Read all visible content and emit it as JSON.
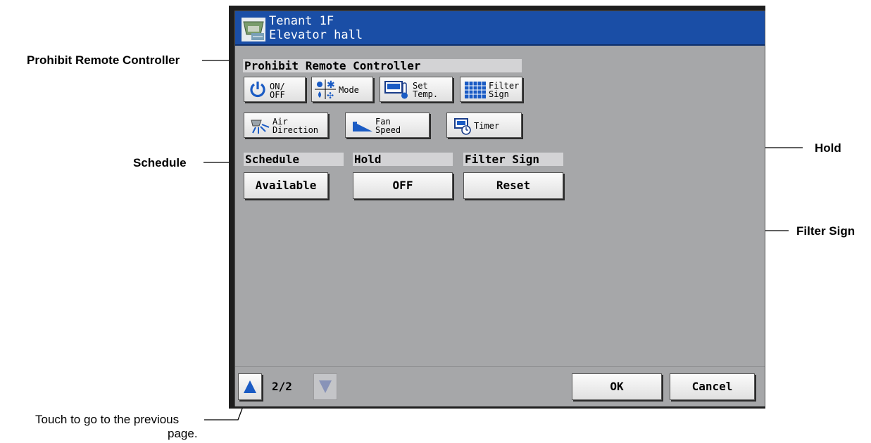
{
  "annotations": {
    "prohibit": "Prohibit Remote Controller",
    "schedule": "Schedule",
    "hold": "Hold",
    "filter_sign": "Filter Sign",
    "touch_prev_line1": "Touch to go to the previous",
    "touch_prev_line2": "page."
  },
  "title": {
    "line1": "Tenant 1F",
    "line2": "Elevator hall"
  },
  "prohibit": {
    "header": "Prohibit Remote Controller",
    "buttons": [
      {
        "id": "on-off",
        "line1": "ON/",
        "line2": "OFF",
        "icon": "power-icon"
      },
      {
        "id": "mode",
        "line1": "Mode",
        "line2": "",
        "icon": "mode-icon"
      },
      {
        "id": "set-temp",
        "line1": "Set",
        "line2": "Temp.",
        "icon": "thermometer-icon"
      },
      {
        "id": "filter-sign",
        "line1": "Filter",
        "line2": "Sign",
        "icon": "filter-grid-icon"
      },
      {
        "id": "air-direction",
        "line1": "Air",
        "line2": "Direction",
        "icon": "air-direction-icon"
      },
      {
        "id": "fan-speed",
        "line1": "Fan",
        "line2": "Speed",
        "icon": "fan-speed-icon"
      },
      {
        "id": "timer",
        "line1": "Timer",
        "line2": "",
        "icon": "timer-icon"
      }
    ]
  },
  "schedule": {
    "header": "Schedule",
    "value": "Available"
  },
  "hold": {
    "header": "Hold",
    "value": "OFF"
  },
  "filter_sign": {
    "header": "Filter Sign",
    "value": "Reset"
  },
  "pager": {
    "text": "2/2"
  },
  "footer": {
    "ok": "OK",
    "cancel": "Cancel"
  },
  "colors": {
    "titlebar": "#1a4ea6",
    "screen": "#a6a7a9",
    "accent_blue": "#1a5bc4"
  }
}
